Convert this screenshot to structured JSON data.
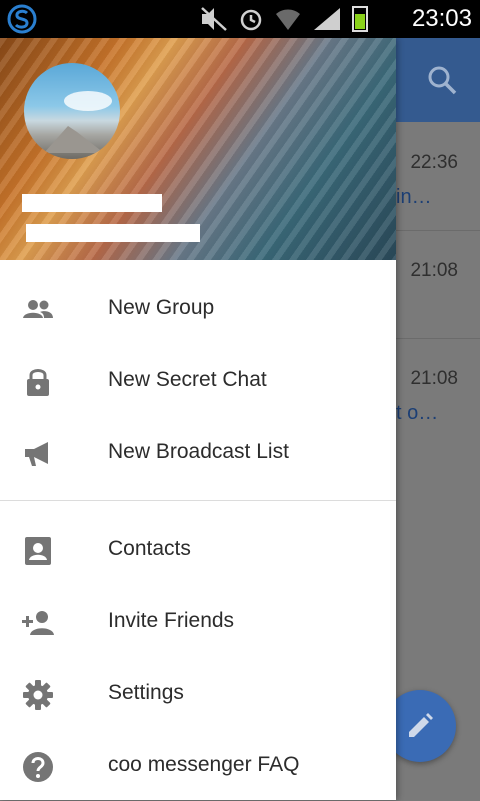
{
  "status_bar": {
    "time": "23:03"
  },
  "background": {
    "rows": [
      {
        "time": "22:36",
        "snippet": "in…"
      },
      {
        "time": "21:08",
        "snippet": ""
      },
      {
        "time": "21:08",
        "snippet": "t o…"
      }
    ]
  },
  "menu": {
    "group1": [
      {
        "label": "New Group",
        "icon": "group-icon"
      },
      {
        "label": "New Secret Chat",
        "icon": "lock-icon"
      },
      {
        "label": "New Broadcast List",
        "icon": "megaphone-icon"
      }
    ],
    "group2": [
      {
        "label": "Contacts",
        "icon": "contact-icon"
      },
      {
        "label": "Invite Friends",
        "icon": "add-person-icon"
      },
      {
        "label": "Settings",
        "icon": "gear-icon"
      },
      {
        "label": "coo messenger FAQ",
        "icon": "help-icon"
      }
    ]
  },
  "colors": {
    "toolbar": "#345a8f",
    "fab": "#3a6bb5",
    "icon": "#757575",
    "text": "#2c2c2c"
  }
}
